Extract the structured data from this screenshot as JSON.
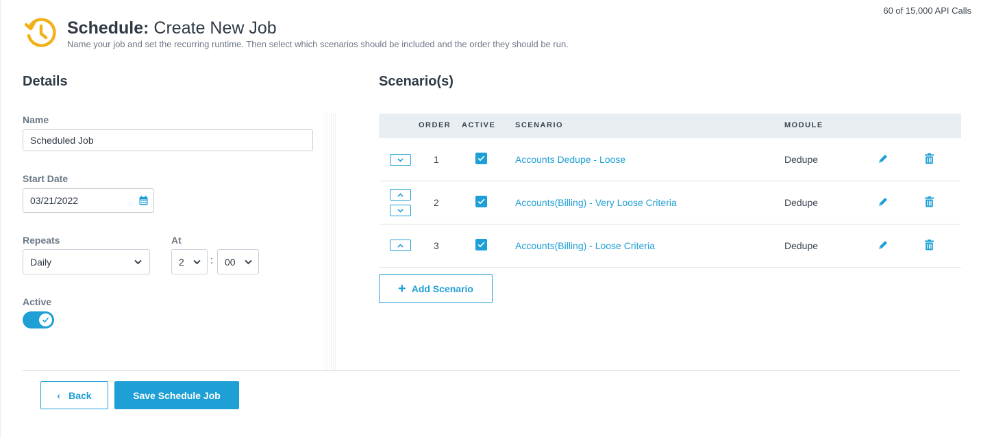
{
  "api_usage": "60 of 15,000 API Calls",
  "header": {
    "title_bold": "Schedule:",
    "title_rest": " Create New Job",
    "subtitle": "Name your job and set the recurring runtime. Then select which scenarios should be included and the order they should be run."
  },
  "details": {
    "title": "Details",
    "name_label": "Name",
    "name_value": "Scheduled Job",
    "start_date_label": "Start Date",
    "start_date_value": "03/21/2022",
    "repeats_label": "Repeats",
    "repeats_value": "Daily",
    "at_label": "At",
    "hour_value": "2",
    "minute_value": "00",
    "time_separator": ":",
    "active_label": "Active",
    "active_on": true
  },
  "scenarios": {
    "title": "Scenario(s)",
    "columns": {
      "order": "ORDER",
      "active": "ACTIVE",
      "scenario": "SCENARIO",
      "module": "MODULE"
    },
    "rows": [
      {
        "order": "1",
        "active": true,
        "scenario": "Accounts Dedupe - Loose",
        "module": "Dedupe"
      },
      {
        "order": "2",
        "active": true,
        "scenario": "Accounts(Billing) - Very Loose Criteria",
        "module": "Dedupe"
      },
      {
        "order": "3",
        "active": true,
        "scenario": "Accounts(Billing) - Loose Criteria",
        "module": "Dedupe"
      }
    ],
    "add_button": "Add Scenario"
  },
  "footer": {
    "back_label": "Back",
    "save_label": "Save Schedule Job"
  },
  "colors": {
    "accent": "#1e9fd6",
    "clock_icon": "#f2b11a",
    "header_bg": "#e9eef2"
  }
}
